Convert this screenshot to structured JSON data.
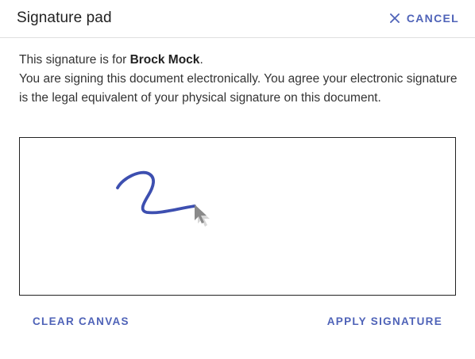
{
  "dialog": {
    "title": "Signature pad",
    "cancel_label": "CANCEL"
  },
  "body": {
    "line1_prefix": "This signature is for ",
    "signer_name": "Brock Mock",
    "line1_suffix": ".",
    "consent_text": "You are signing this document electronically. You agree your electronic signature is the legal equivalent of your physical signature on this document."
  },
  "footer": {
    "clear_label": "CLEAR CANVAS",
    "apply_label": "APPLY SIGNATURE"
  },
  "colors": {
    "accent": "#4f63b8",
    "stroke": "#3d4fb0"
  },
  "icons": {
    "cancel": "close-icon",
    "cursor": "mouse-pointer-icon"
  }
}
